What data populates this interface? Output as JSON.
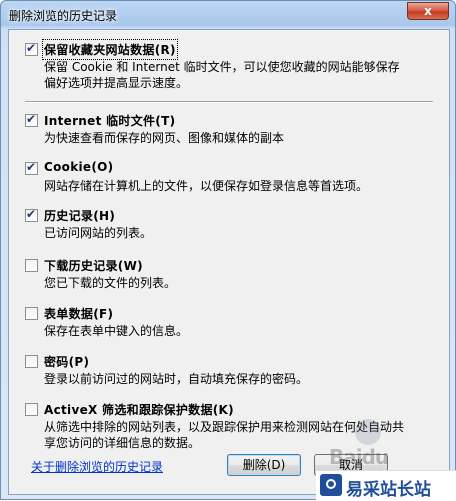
{
  "window": {
    "title": "删除浏览的历史记录",
    "close_glyph": "x"
  },
  "options": [
    {
      "label": "保留收藏夹网站数据(R)",
      "checked": true,
      "desc_lines": [
        "保留 Cookie 和 Internet 临时文件，可以使您收藏的网站能够保存",
        "偏好选项并提高显示速度。"
      ]
    },
    {
      "label": "Internet 临时文件(T)",
      "checked": true,
      "desc_lines": [
        "为快速查看而保存的网页、图像和媒体的副本"
      ]
    },
    {
      "label": "Cookie(O)",
      "checked": true,
      "desc_lines": [
        "网站存储在计算机上的文件，以便保存如登录信息等首选项。"
      ]
    },
    {
      "label": "历史记录(H)",
      "checked": true,
      "desc_lines": [
        "已访问网站的列表。"
      ]
    },
    {
      "label": "下载历史记录(W)",
      "checked": false,
      "desc_lines": [
        "您已下载的文件的列表。"
      ]
    },
    {
      "label": "表单数据(F)",
      "checked": false,
      "desc_lines": [
        "保存在表单中键入的信息。"
      ]
    },
    {
      "label": "密码(P)",
      "checked": false,
      "desc_lines": [
        "登录以前访问过的网站时，自动填充保存的密码。"
      ]
    },
    {
      "label": "ActiveX 筛选和跟踪保护数据(K)",
      "checked": false,
      "desc_lines": [
        "从筛选中排除的网站列表，以及跟踪保护用来检测网站在何处自动共",
        "享您访问的详细信息的数据。"
      ]
    }
  ],
  "footer": {
    "about_link": "关于删除浏览的历史记录",
    "delete_button": "删除(D)",
    "cancel_button": "取消"
  },
  "watermark": {
    "baidu": "Baidu",
    "site_name": "易采站长站"
  }
}
